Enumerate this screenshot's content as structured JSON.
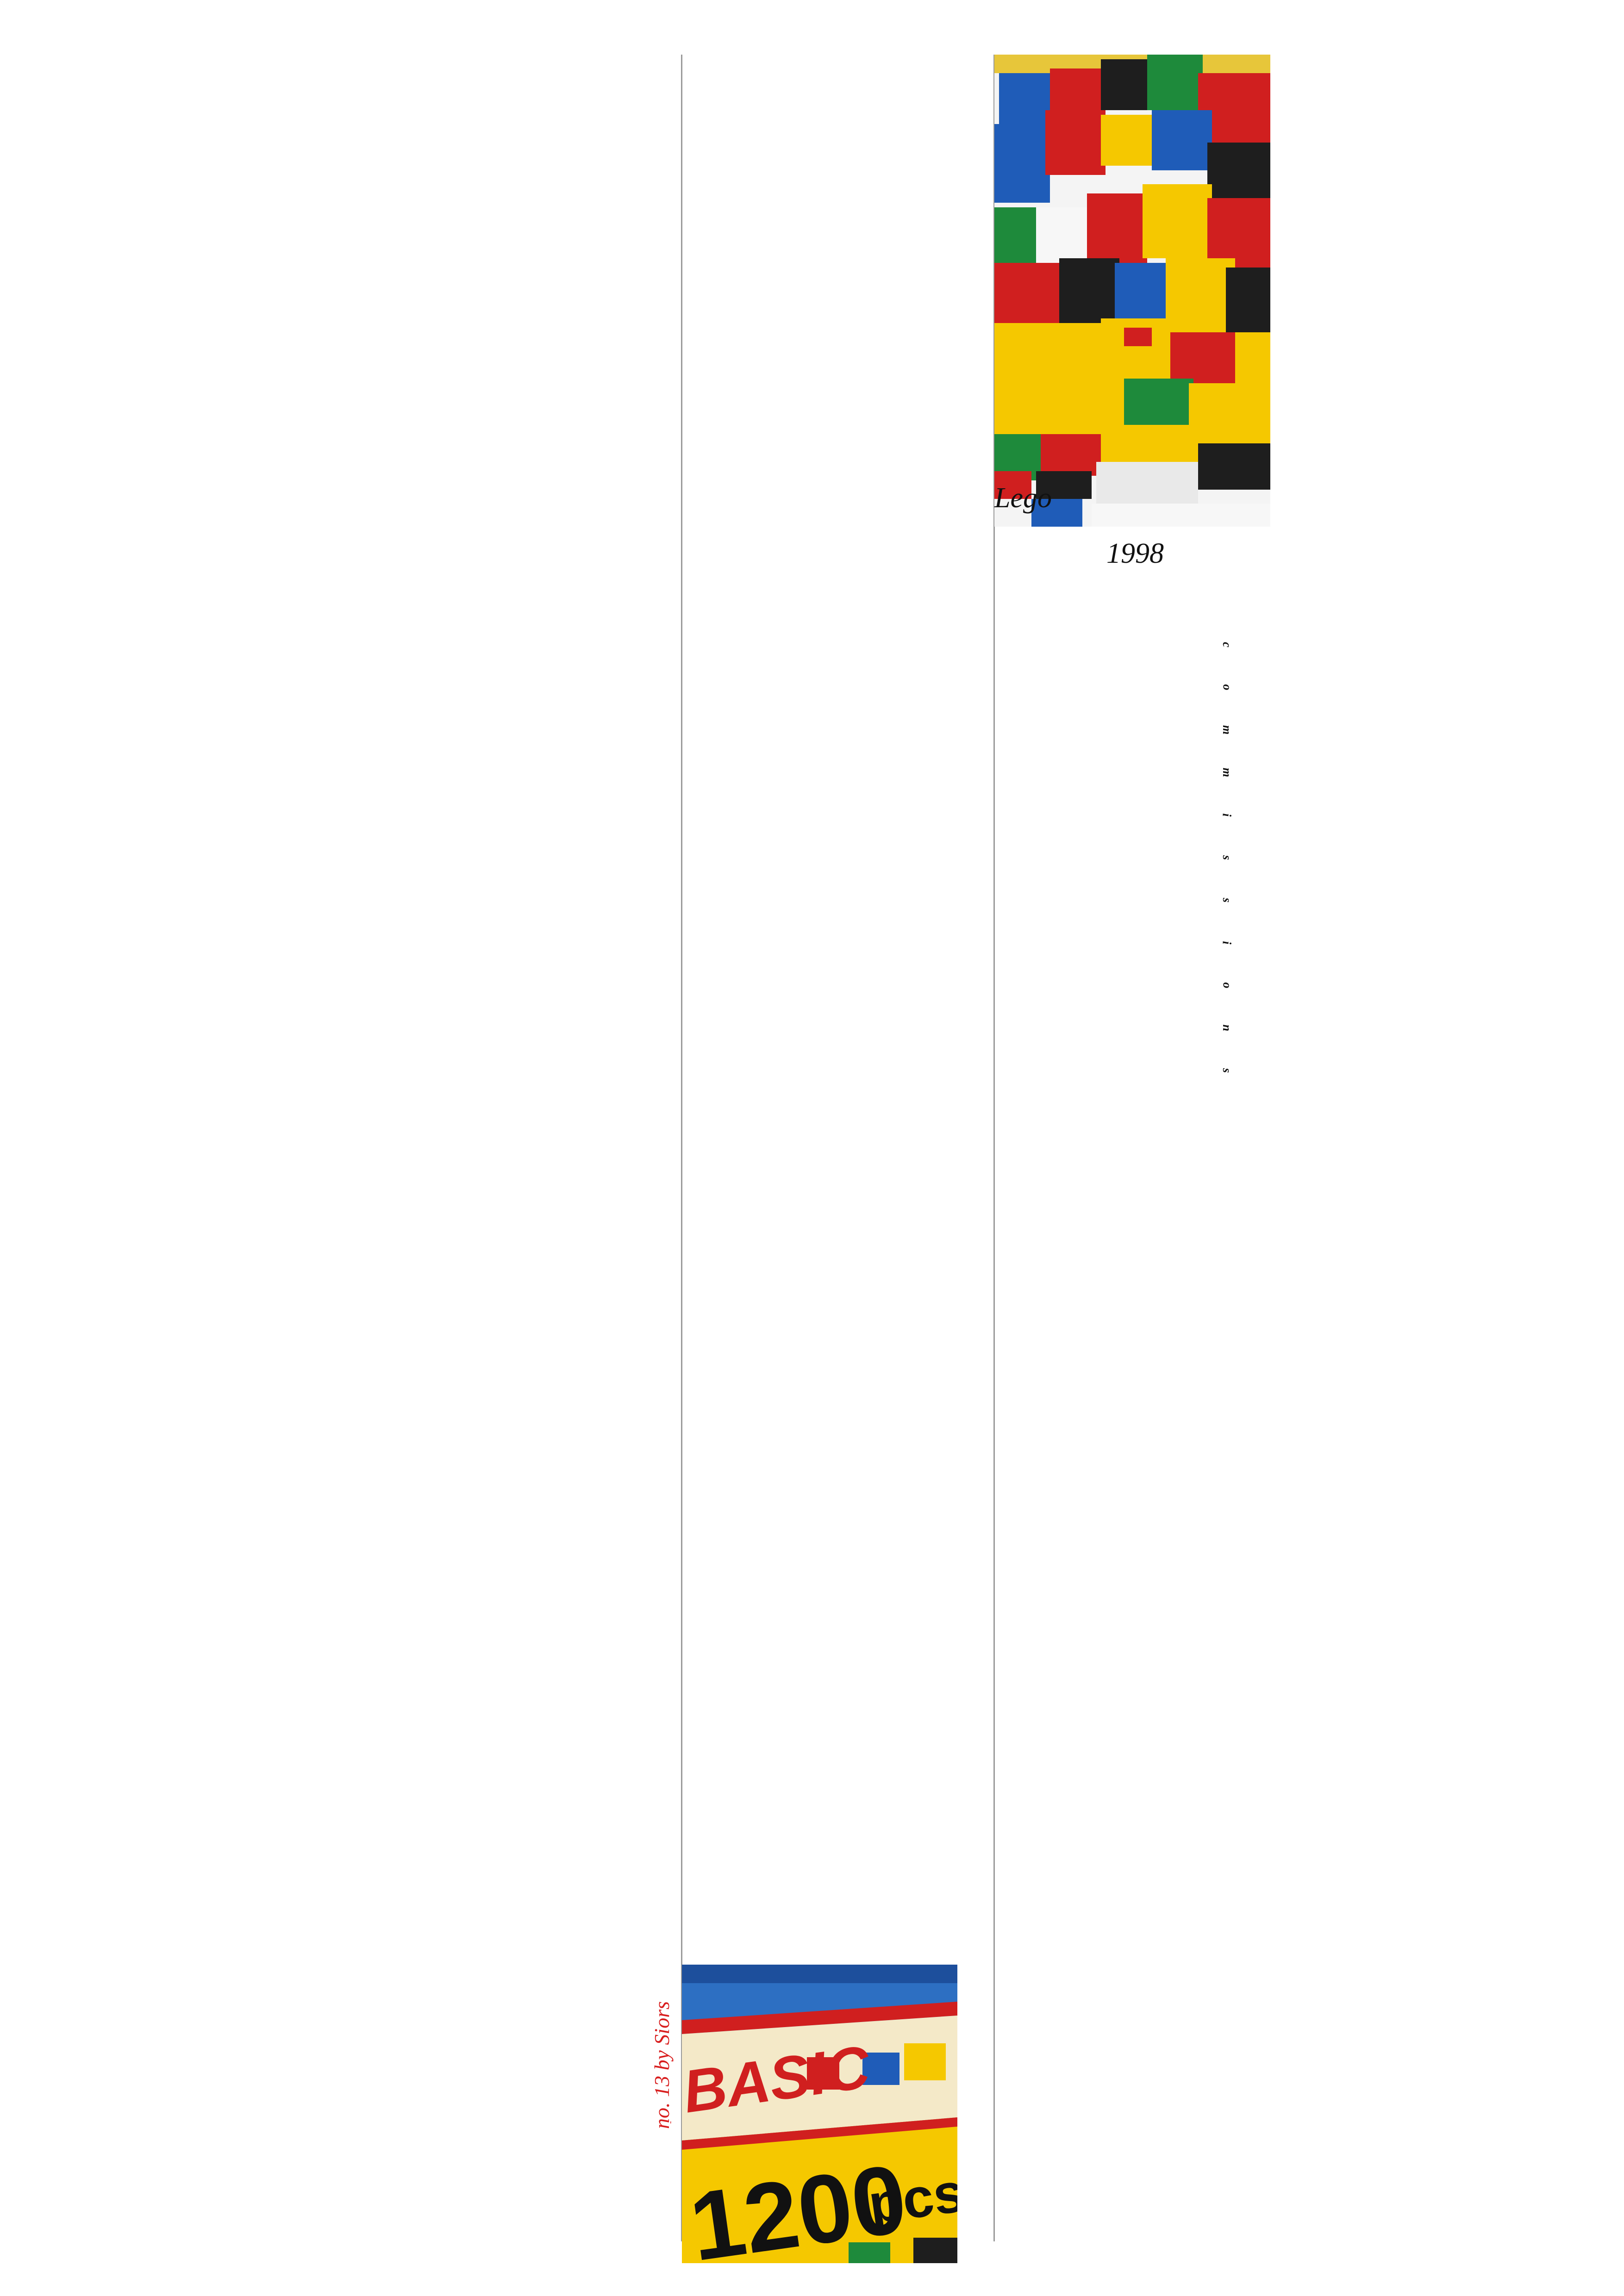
{
  "captions": {
    "title": "Lego",
    "year": "1998"
  },
  "vertical_word": [
    "c",
    "o",
    "m",
    "m",
    "i",
    "s",
    "s",
    "i",
    "o",
    "n",
    "s"
  ],
  "credit": {
    "text": "no. 13 by Siors",
    "mark": "'"
  },
  "box_art": {
    "label": "BASIC",
    "count": "1200",
    "unit": "pcs/"
  },
  "colors": {
    "rule": "#9a9a9a",
    "credit": "#d81e1e",
    "lego_red": "#d01f1f",
    "lego_yellow": "#f5c800",
    "lego_blue": "#1f5cb8",
    "lego_green": "#1e8a3b"
  }
}
